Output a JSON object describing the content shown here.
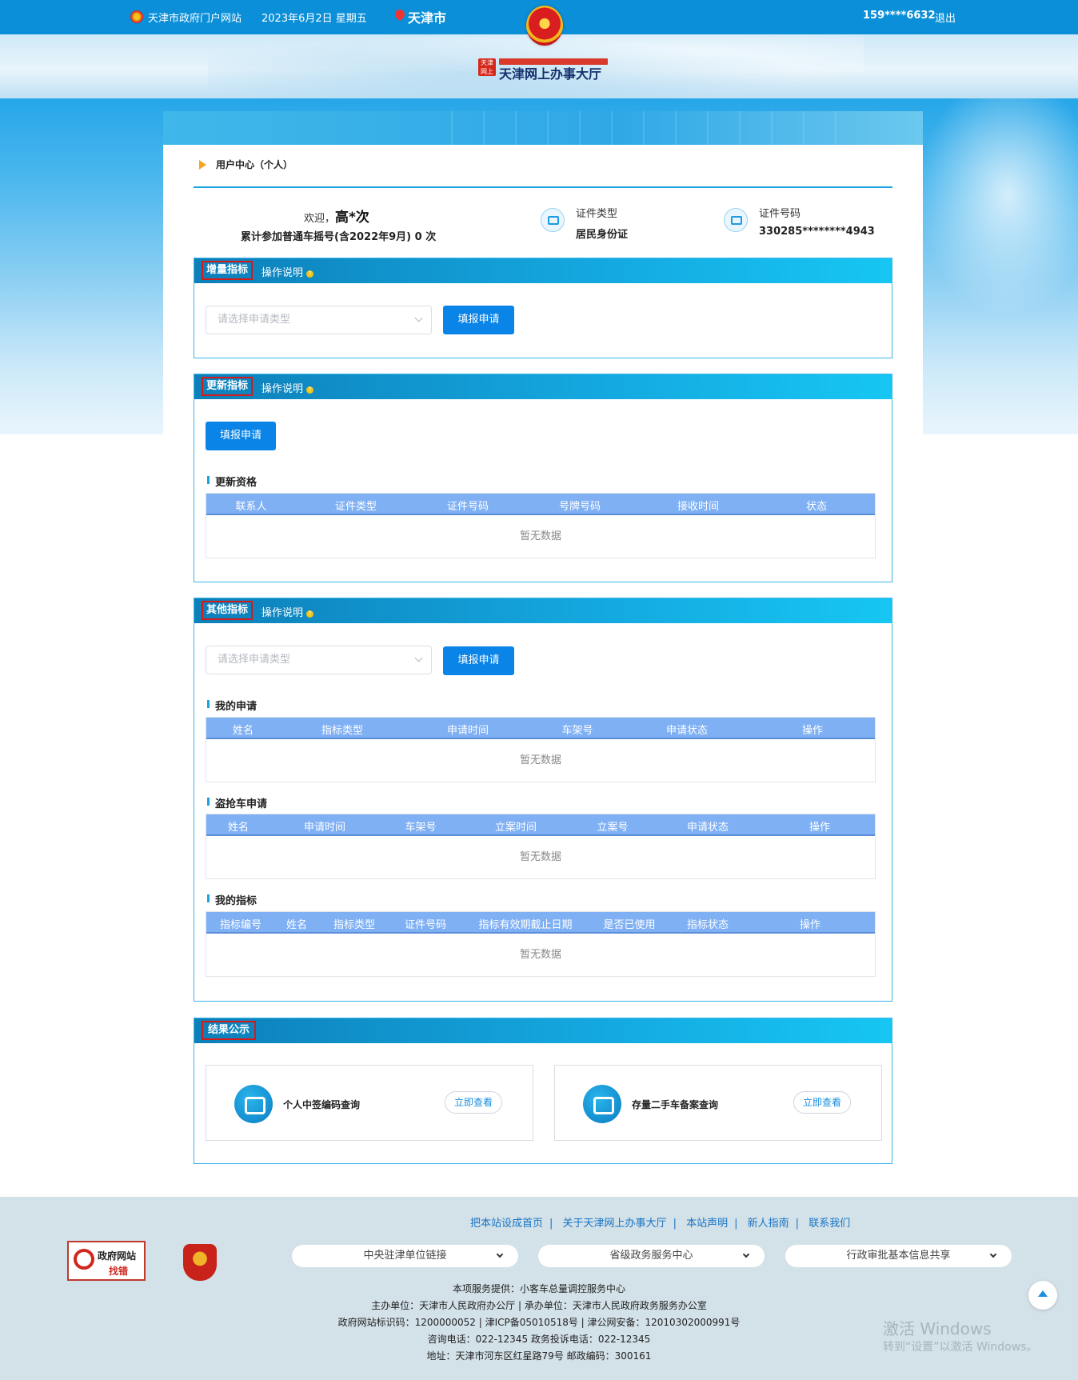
{
  "topbar": {
    "portal": "天津市政府门户网站",
    "date": "2023年6月2日 星期五",
    "city": "天津市",
    "user": "159****6632",
    "logout": "退出"
  },
  "logo": {
    "badge": "天津网上",
    "title": "天津网上办事大厅"
  },
  "user_center": {
    "title": "用户中心（个人）",
    "welcome_prefix": "欢迎，",
    "user_name": "高*次",
    "count_text": "累计参加普通车摇号(含2022年9月) 0 次",
    "id_type_label": "证件类型",
    "id_type_value": "居民身份证",
    "id_number_label": "证件号码",
    "id_number_value": "330285********4943"
  },
  "sections": {
    "increment": {
      "tag": "增量指标",
      "help": "操作说明",
      "select_placeholder": "请选择申请类型",
      "button": "填报申请"
    },
    "renew": {
      "tag": "更新指标",
      "help": "操作说明",
      "button": "填报申请",
      "table_title": "更新资格",
      "columns": [
        "联系人",
        "证件类型",
        "证件号码",
        "号牌号码",
        "接收时间",
        "状态"
      ],
      "empty": "暂无数据"
    },
    "other": {
      "tag": "其他指标",
      "help": "操作说明",
      "select_placeholder": "请选择申请类型",
      "button": "填报申请",
      "my_apply": {
        "title": "我的申请",
        "columns": [
          "姓名",
          "指标类型",
          "申请时间",
          "车架号",
          "申请状态",
          "操作"
        ],
        "empty": "暂无数据"
      },
      "stolen": {
        "title": "盗抢车申请",
        "columns": [
          "姓名",
          "申请时间",
          "车架号",
          "立案时间",
          "立案号",
          "申请状态",
          "操作"
        ],
        "empty": "暂无数据"
      },
      "my_index": {
        "title": "我的指标",
        "columns": [
          "指标编号",
          "姓名",
          "指标类型",
          "证件号码",
          "指标有效期截止日期",
          "是否已使用",
          "指标状态",
          "操作"
        ],
        "empty": "暂无数据"
      }
    },
    "results": {
      "tag": "结果公示",
      "cards": [
        {
          "icon": "car-check-icon",
          "label": "个人中签编码查询",
          "button": "立即查看"
        },
        {
          "icon": "scale-icon",
          "label": "存量二手车备案查询",
          "button": "立即查看"
        }
      ]
    }
  },
  "footer": {
    "links": [
      "把本站设成首页",
      "关于天津网上办事大厅",
      "本站声明",
      "新人指南",
      "联系我们"
    ],
    "selects": [
      "中央驻津单位链接",
      "省级政务服务中心",
      "行政审批基本信息共享"
    ],
    "find_error_1": "政府网站",
    "find_error_2": "找错",
    "line1": "本项服务提供：小客车总量调控服务中心",
    "line2": "主办单位：天津市人民政府办公厅 | 承办单位：天津市人民政府政务服务办公室",
    "line3": "政府网站标识码：1200000052 | 津ICP备05010518号 | 津公网安备：12010302000991号",
    "line4": "咨询电话：022-12345 政务投诉电话：022-12345",
    "line5": "地址：天津市河东区红星路79号 邮政编码：300161"
  },
  "watermark": {
    "line1": "激活 Windows",
    "line2": "转到“设置”以激活 Windows。"
  },
  "colors": {
    "primary": "#0a84e6",
    "header_blue": "#0b8fd8",
    "table_head": "#7fb0f4",
    "tag_border": "#d61a1a"
  }
}
